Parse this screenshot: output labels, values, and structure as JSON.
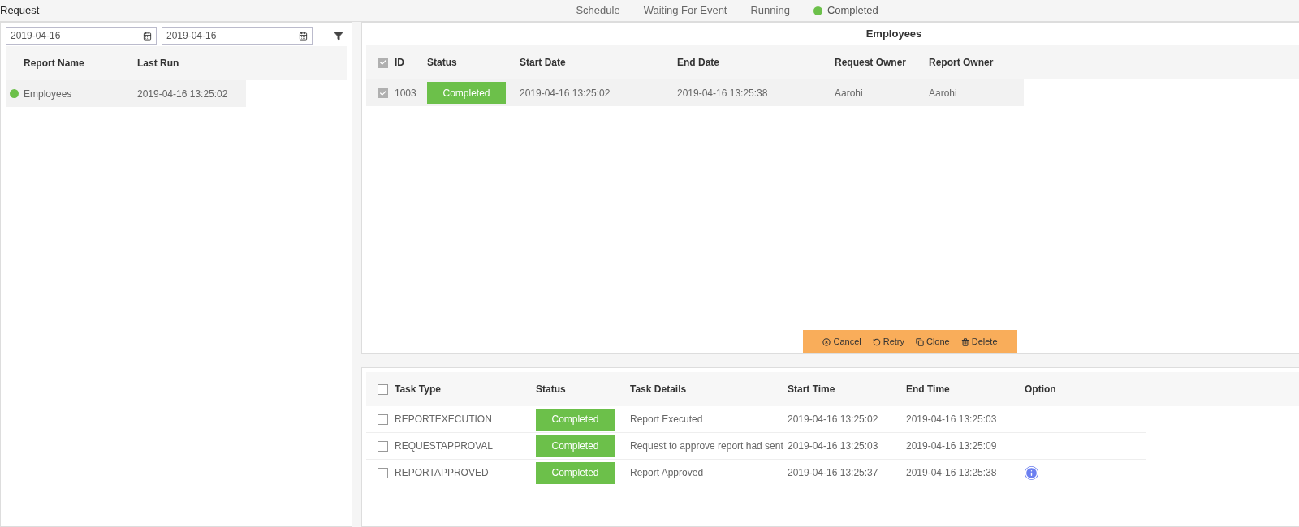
{
  "title": "Request",
  "status_tabs": [
    {
      "label": "Schedule",
      "selected": false
    },
    {
      "label": "Waiting For Event",
      "selected": false
    },
    {
      "label": "Running",
      "selected": false
    },
    {
      "label": "Completed",
      "selected": true
    }
  ],
  "filters": {
    "from_date": "2019-04-16",
    "to_date": "2019-04-16"
  },
  "reports": {
    "columns": [
      "Report Name",
      "Last Run"
    ],
    "rows": [
      {
        "name": "Employees",
        "last_run": "2019-04-16 13:25:02",
        "color": "#6cc04a",
        "selected": true
      }
    ]
  },
  "requests": {
    "title": "Employees",
    "all_checked": true,
    "columns": [
      "ID",
      "Status",
      "Start Date",
      "End Date",
      "Request Owner",
      "Report Owner"
    ],
    "rows": [
      {
        "checked": true,
        "id": "1003",
        "status": "Completed",
        "start": "2019-04-16 13:25:02",
        "end": "2019-04-16 13:25:38",
        "request_owner": "Aarohi",
        "report_owner": "Aarohi"
      }
    ],
    "actions": [
      {
        "kind": "cancel",
        "label": "Cancel"
      },
      {
        "kind": "retry",
        "label": "Retry"
      },
      {
        "kind": "clone",
        "label": "Clone"
      },
      {
        "kind": "delete",
        "label": "Delete"
      }
    ]
  },
  "tasks": {
    "all_checked": false,
    "columns": [
      "Task Type",
      "Status",
      "Task Details",
      "Start Time",
      "End Time",
      "Option"
    ],
    "rows": [
      {
        "checked": false,
        "type": "REPORTEXECUTION",
        "status": "Completed",
        "details": "Report Executed",
        "start": "2019-04-16 13:25:02",
        "end": "2019-04-16 13:25:03",
        "info": false
      },
      {
        "checked": false,
        "type": "REQUESTAPPROVAL",
        "status": "Completed",
        "details": "Request to approve report had sent",
        "start": "2019-04-16 13:25:03",
        "end": "2019-04-16 13:25:09",
        "info": false
      },
      {
        "checked": false,
        "type": "REPORTAPPROVED",
        "status": "Completed",
        "details": "Report Approved",
        "start": "2019-04-16 13:25:37",
        "end": "2019-04-16 13:25:38",
        "info": true
      }
    ]
  }
}
